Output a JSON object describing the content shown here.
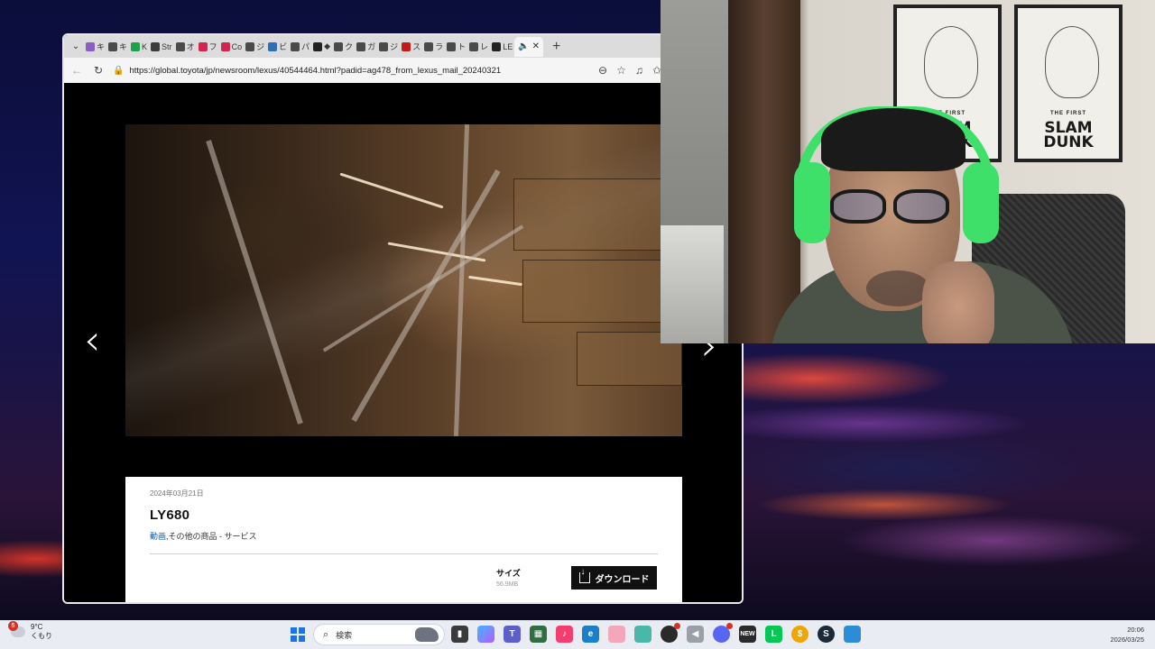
{
  "browser": {
    "tabs": [
      {
        "label": "キ",
        "color": "#8a5fbf"
      },
      {
        "label": "キ",
        "color": "#4a4a4a"
      },
      {
        "label": "K",
        "color": "#1aa34a"
      },
      {
        "label": "Str",
        "color": "#3c3c3c"
      },
      {
        "label": "オ",
        "color": "#4a4a4a"
      },
      {
        "label": "フ",
        "color": "#d1264f"
      },
      {
        "label": "Co",
        "color": "#d1264f"
      },
      {
        "label": "ジ",
        "color": "#4a4a4a"
      },
      {
        "label": "ビ",
        "color": "#2f6fb5"
      },
      {
        "label": "パ",
        "color": "#4a4a4a"
      },
      {
        "label": "◆",
        "color": "#222222"
      },
      {
        "label": "ク",
        "color": "#4a4a4a"
      },
      {
        "label": "ガ",
        "color": "#4a4a4a"
      },
      {
        "label": "ジ",
        "color": "#4a4a4a"
      },
      {
        "label": "ス",
        "color": "#c41a1a"
      },
      {
        "label": "ラ",
        "color": "#4a4a4a"
      },
      {
        "label": "ト",
        "color": "#4a4a4a"
      },
      {
        "label": "レ",
        "color": "#4a4a4a"
      },
      {
        "label": "LE",
        "color": "#222222"
      }
    ],
    "active_tab_label": "",
    "url": "https://global.toyota/jp/newsroom/lexus/40544464.html?padid=ag478_from_lexus_mail_20240321"
  },
  "card": {
    "date": "2024年03月21日",
    "title": "LY680",
    "tag_link": "動画",
    "tags_rest": ",その他の商品 - サービス",
    "size_label": "サイズ",
    "size_value": "56.9MB",
    "download_label": "ダウンロード"
  },
  "webcam": {
    "poster_subtitle": "THE FIRST",
    "poster_title_line1": "SLAM",
    "poster_title_line2": "DUNK"
  },
  "taskbar": {
    "weather_temp": "9°C",
    "weather_desc": "くもり",
    "weather_badge": "5",
    "search_placeholder": "検索",
    "time": "20:06",
    "date": "2026/03/25"
  }
}
